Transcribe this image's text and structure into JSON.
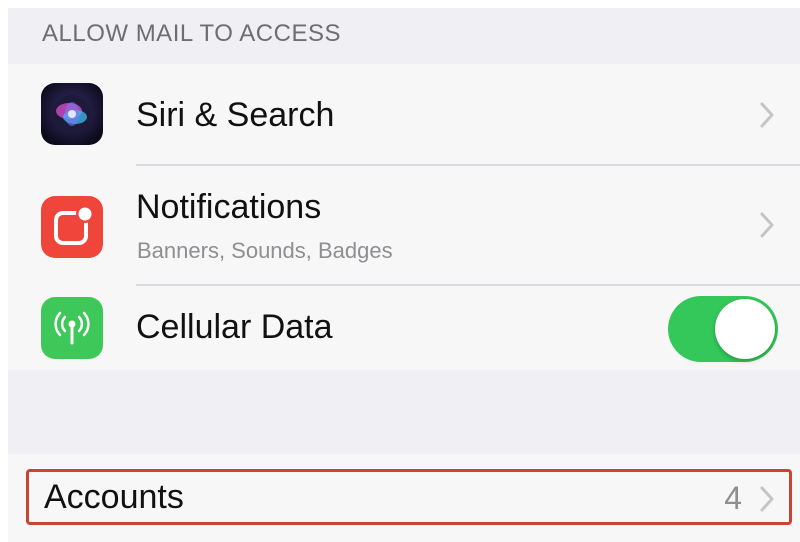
{
  "section_header": "ALLOW MAIL TO ACCESS",
  "rows": [
    {
      "title": "Siri & Search",
      "subtitle": "",
      "icon": "siri-icon",
      "accessory": "chevron"
    },
    {
      "title": "Notifications",
      "subtitle": "Banners, Sounds, Badges",
      "icon": "notifications-icon",
      "accessory": "chevron"
    },
    {
      "title": "Cellular Data",
      "subtitle": "",
      "icon": "cellular-antenna-icon",
      "accessory": "toggle",
      "toggle_on": true
    }
  ],
  "accounts": {
    "title": "Accounts",
    "count": "4"
  },
  "colors": {
    "toggle_on": "#34c759",
    "notifications_icon": "#f0453a",
    "cellular_icon": "#3fc85a",
    "highlight_outline": "#c8452f"
  }
}
